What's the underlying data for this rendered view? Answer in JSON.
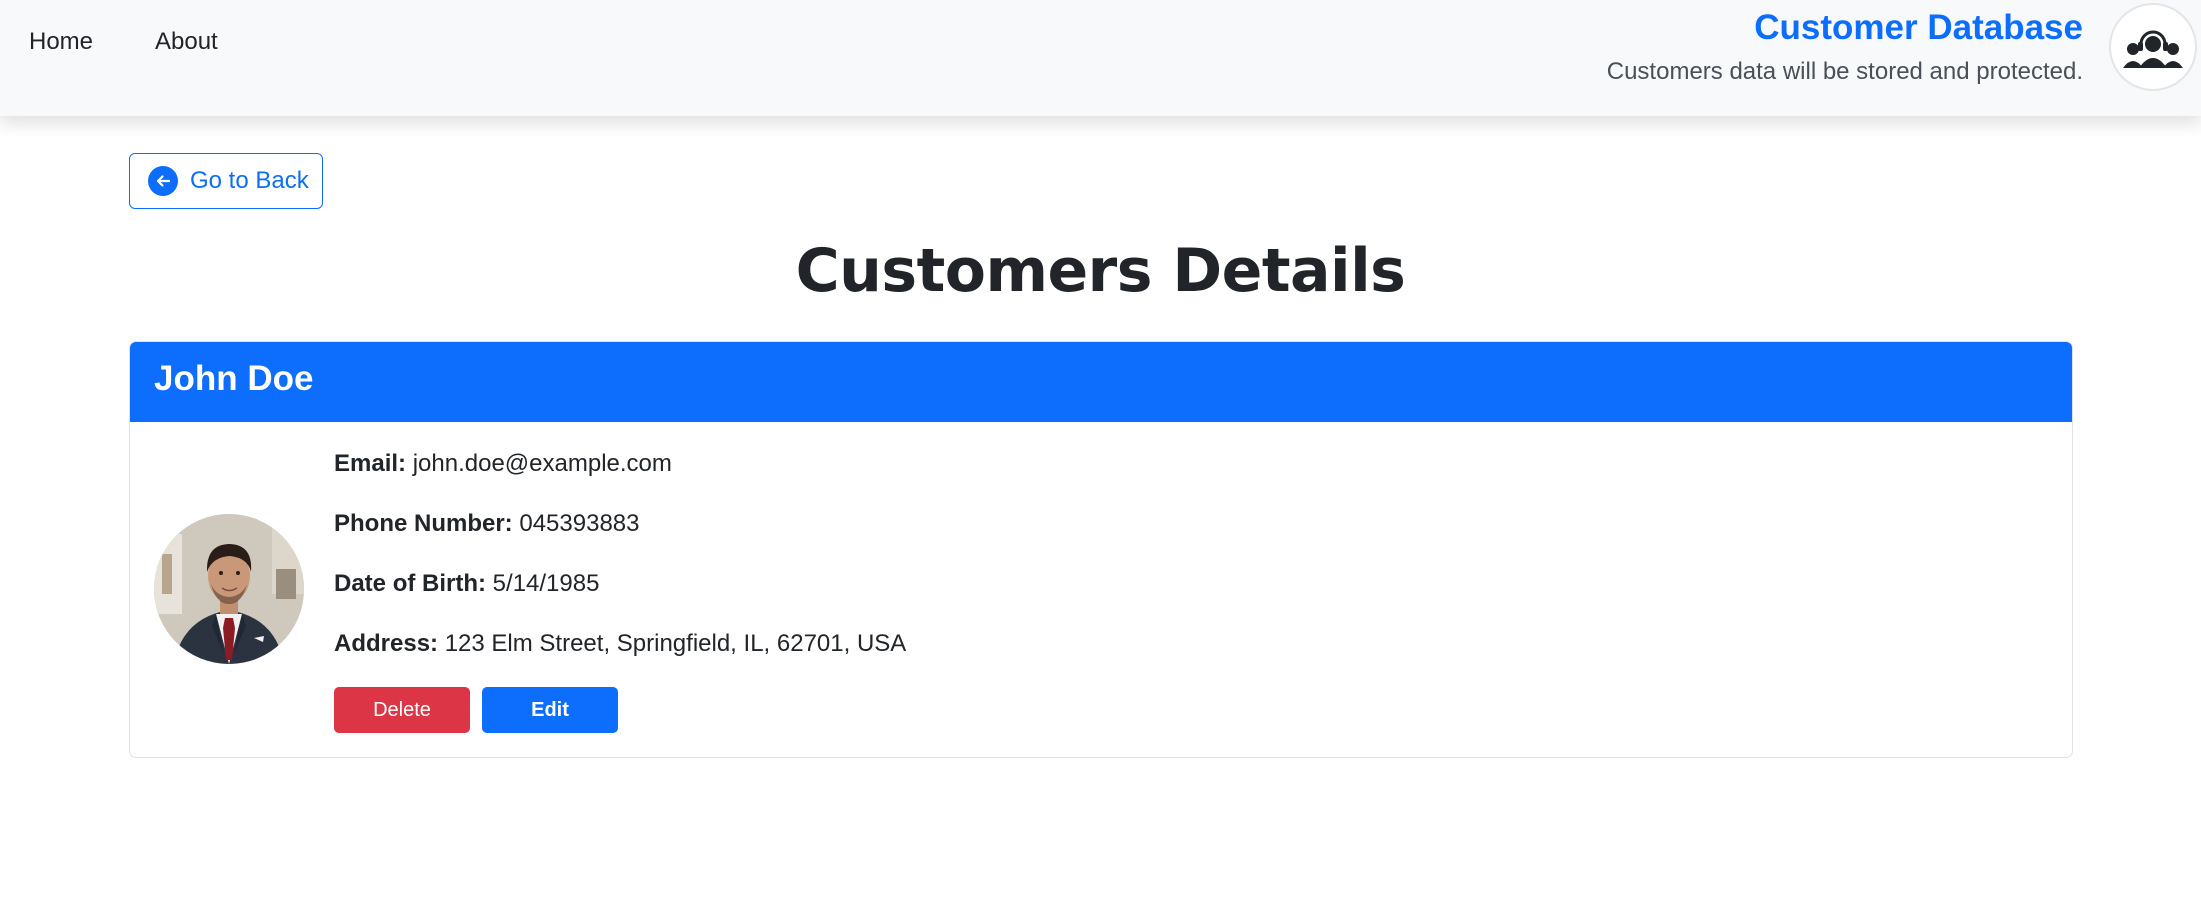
{
  "nav": {
    "links": [
      {
        "label": "Home"
      },
      {
        "label": "About"
      }
    ]
  },
  "brand": {
    "title": "Customer Database",
    "subtitle": "Customers data will be stored and protected.",
    "logo_icon": "customer-group-icon"
  },
  "back": {
    "label": "Go to Back",
    "icon": "arrow-left-circle-icon"
  },
  "page": {
    "title": "Customers Details"
  },
  "customer": {
    "name": "John Doe",
    "fields": [
      {
        "label": "Email:",
        "value": "john.doe@example.com"
      },
      {
        "label": "Phone Number:",
        "value": "045393883"
      },
      {
        "label": "Date of Birth:",
        "value": "5/14/1985"
      },
      {
        "label": "Address:",
        "value": "123 Elm Street, Springfield, IL, 62701, USA"
      }
    ]
  },
  "actions": {
    "delete_label": "Delete",
    "edit_label": "Edit"
  },
  "colors": {
    "primary": "#0d6efd",
    "danger": "#dc3545",
    "navbar_bg": "#f8f9fa"
  }
}
